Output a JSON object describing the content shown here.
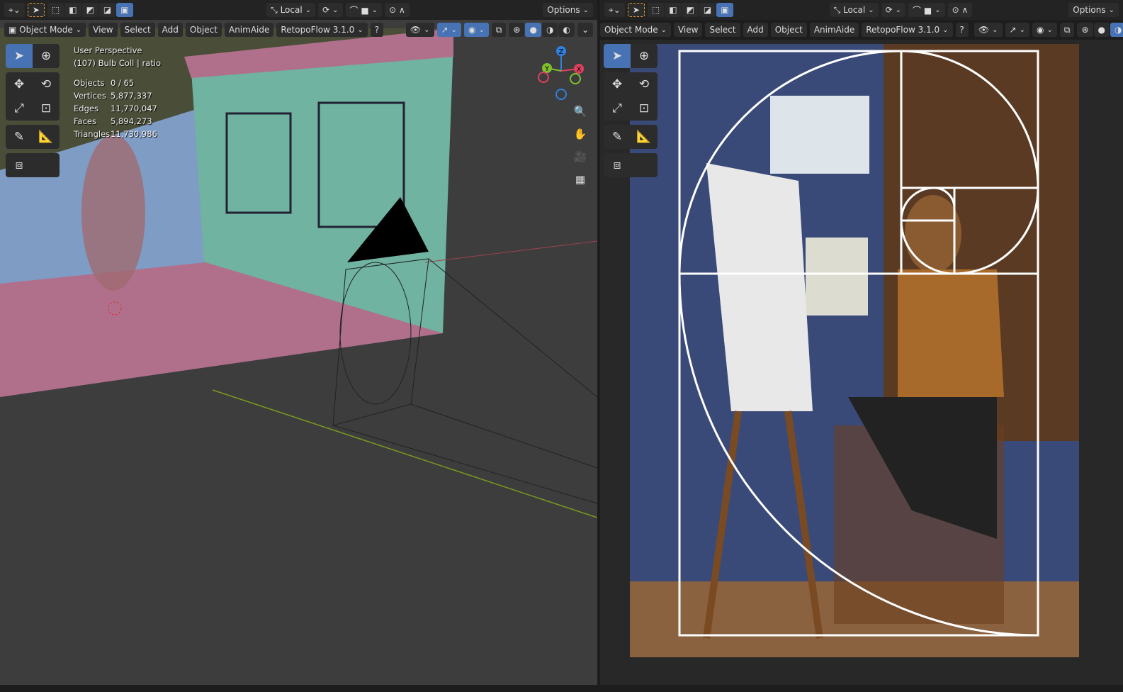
{
  "left_viewport": {
    "header_top": {
      "local_label": "Local",
      "options_label": "Options"
    },
    "header_menu": {
      "mode": "Object Mode",
      "menus": [
        "View",
        "Select",
        "Add",
        "Object",
        "AnimAide"
      ],
      "addon": "RetopoFlow 3.1.0"
    },
    "overlay": {
      "view_name": "User Perspective",
      "collection": "(107) Bulb Coll | ratio",
      "stats": [
        {
          "label": "Objects",
          "value": "0 / 65"
        },
        {
          "label": "Vertices",
          "value": "5,877,337"
        },
        {
          "label": "Edges",
          "value": "11,770,047"
        },
        {
          "label": "Faces",
          "value": "5,894,273"
        },
        {
          "label": "Triangles",
          "value": "11,730,986"
        }
      ]
    },
    "gizmo": {
      "x": "X",
      "y": "Y",
      "z": "Z"
    }
  },
  "right_viewport": {
    "header_top": {
      "local_label": "Local",
      "options_label": "Options"
    },
    "header_menu": {
      "mode": "Object Mode",
      "menus": [
        "View",
        "Select",
        "Add",
        "Object",
        "AnimAide"
      ],
      "addon": "RetopoFlow 3.1.0"
    }
  },
  "tools": [
    "select-box",
    "cursor",
    "move",
    "rotate",
    "scale",
    "transform",
    "annotate",
    "measure",
    "add-cube"
  ],
  "colors": {
    "accent": "#4772b3",
    "viewport_bg": "#3d3d3d",
    "header_bg": "#232323",
    "wall_green": "#6fb3a0",
    "floor_pink": "#b0708c",
    "axis_x": "#e04060",
    "axis_y": "#80c030",
    "axis_z": "#3080e0"
  }
}
